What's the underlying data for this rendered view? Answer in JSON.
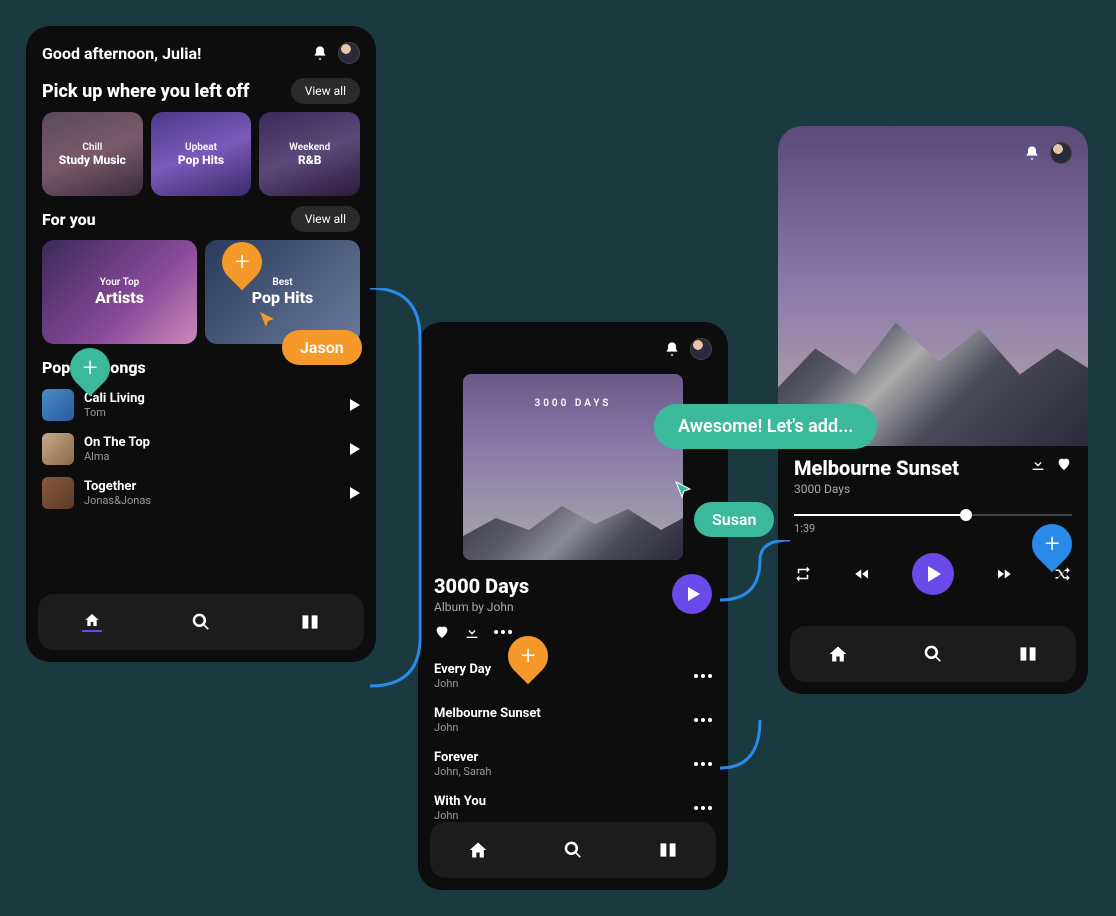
{
  "home": {
    "greeting": "Good afternoon, Julia!",
    "pickup_title": "Pick up where you left off",
    "viewall": "View all",
    "cards": [
      {
        "sub": "Chill",
        "title": "Study Music"
      },
      {
        "sub": "Upbeat",
        "title": "Pop Hits"
      },
      {
        "sub": "Weekend",
        "title": "R&B"
      }
    ],
    "foryou_title": "For you",
    "foryou_cards": [
      {
        "sub": "Your Top",
        "title": "Artists"
      },
      {
        "sub": "Best",
        "title": "Pop Hits"
      }
    ],
    "popular_title": "Popular songs",
    "songs": [
      {
        "title": "Cali Living",
        "artist": "Tom"
      },
      {
        "title": "On The Top",
        "artist": "Alma"
      },
      {
        "title": "Together",
        "artist": "Jonas&Jonas"
      }
    ]
  },
  "album": {
    "cover_label": "3000 DAYS",
    "title": "3000 Days",
    "subtitle": "Album by John",
    "tracks": [
      {
        "title": "Every Day",
        "artist": "John"
      },
      {
        "title": "Melbourne Sunset",
        "artist": "John"
      },
      {
        "title": "Forever",
        "artist": "John, Sarah"
      },
      {
        "title": "With You",
        "artist": "John"
      }
    ]
  },
  "player": {
    "title": "Melbourne Sunset",
    "subtitle": "3000 Days",
    "time": "1:39"
  },
  "cursors": {
    "jason": "Jason",
    "susan": "Susan",
    "comment": "Awesome! Let's add..."
  },
  "colors": {
    "orange": "#f59a2a",
    "teal": "#3aba9a",
    "blue": "#2a8aea",
    "purple": "#6a4ae8"
  }
}
